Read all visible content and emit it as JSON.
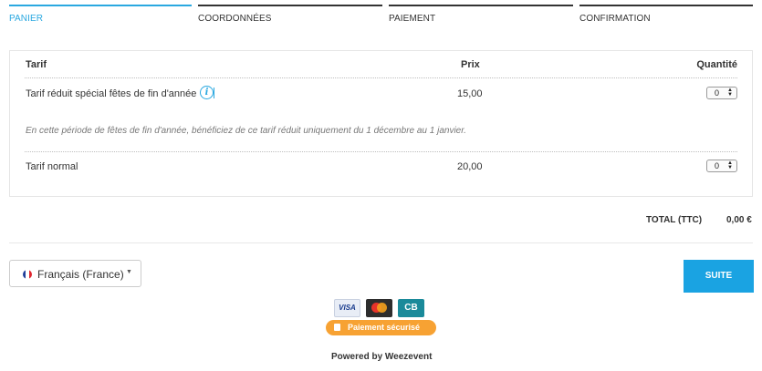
{
  "steps": [
    {
      "label": "PANIER"
    },
    {
      "label": "COORDONNÉES"
    },
    {
      "label": "PAIEMENT"
    },
    {
      "label": "CONFIRMATION"
    }
  ],
  "table": {
    "headers": {
      "tarif": "Tarif",
      "prix": "Prix",
      "quantite": "Quantité"
    },
    "rows": [
      {
        "name": "Tarif réduit spécial fêtes de fin d'année",
        "price": "15,00",
        "quantity": "0",
        "info_icon": "i"
      },
      {
        "name": "Tarif normal",
        "price": "20,00",
        "quantity": "0"
      }
    ],
    "description": "En cette période de fêtes de fin d'année, bénéficiez de ce tarif réduit uniquement du 1 décembre au 1 janvier."
  },
  "total": {
    "label": "TOTAL (TTC)",
    "value": "0,00 €"
  },
  "language": {
    "label": "Français (France)"
  },
  "suite_button": {
    "label": "SUITE"
  },
  "cards": {
    "visa": "VISA",
    "cb": "CB"
  },
  "secure_badge": {
    "label": "Paiement sécurisé"
  },
  "footer": {
    "powered": "Powered by Weezevent"
  },
  "colors": {
    "accent": "#1aa3e2",
    "secure": "#f7a233",
    "step_active": "#2aa8e0"
  }
}
